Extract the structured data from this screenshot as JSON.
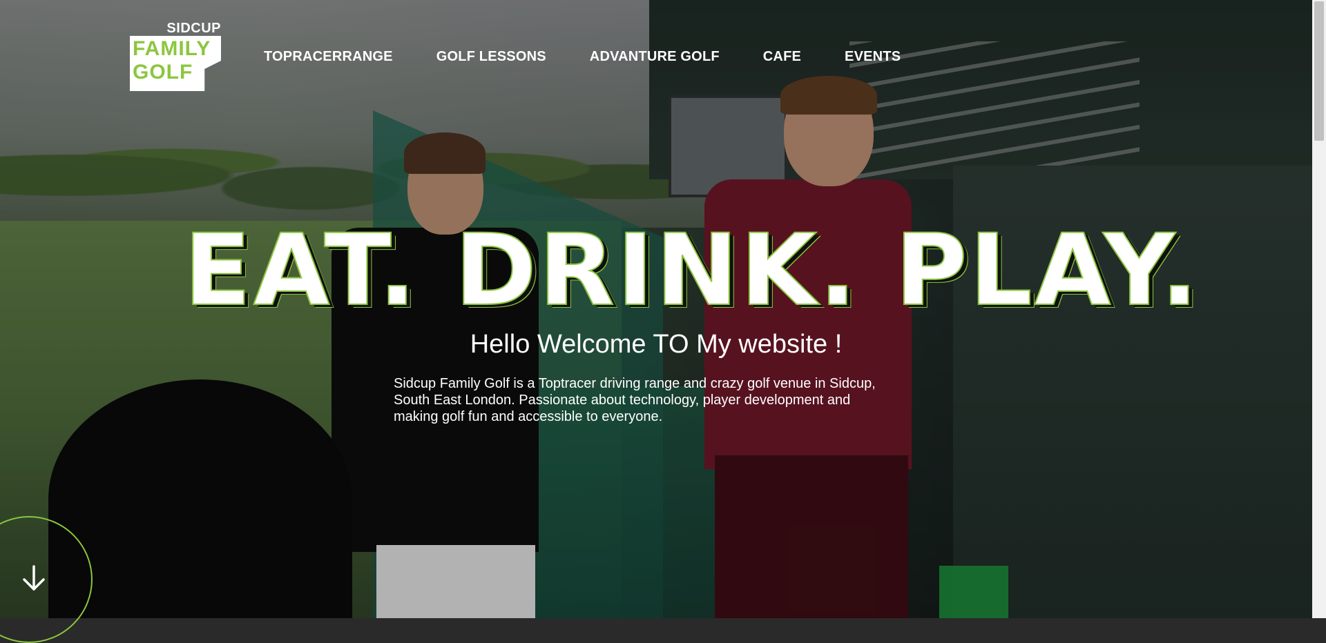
{
  "logo": {
    "top_text": "SIDCUP",
    "line1": "FAMILY",
    "line2": "GOLF"
  },
  "nav": {
    "items": [
      {
        "label": "TOPRACERRANGE"
      },
      {
        "label": "GOLF LESSONS"
      },
      {
        "label": "ADVANTURE GOLF"
      },
      {
        "label": "CAFE"
      },
      {
        "label": "EVENTS"
      }
    ]
  },
  "hero": {
    "headline": "EAT. DRINK. PLAY.",
    "welcome": "Hello Welcome TO My website !",
    "intro": "Sidcup Family Golf is a Toptracer driving range and crazy golf venue in Sidcup, South East London. Passionate about technology, player development and making golf fun and accessible to everyone.",
    "scroll_icon": "arrow-down-icon"
  },
  "colors": {
    "accent": "#8cc63f",
    "text": "#ffffff"
  }
}
